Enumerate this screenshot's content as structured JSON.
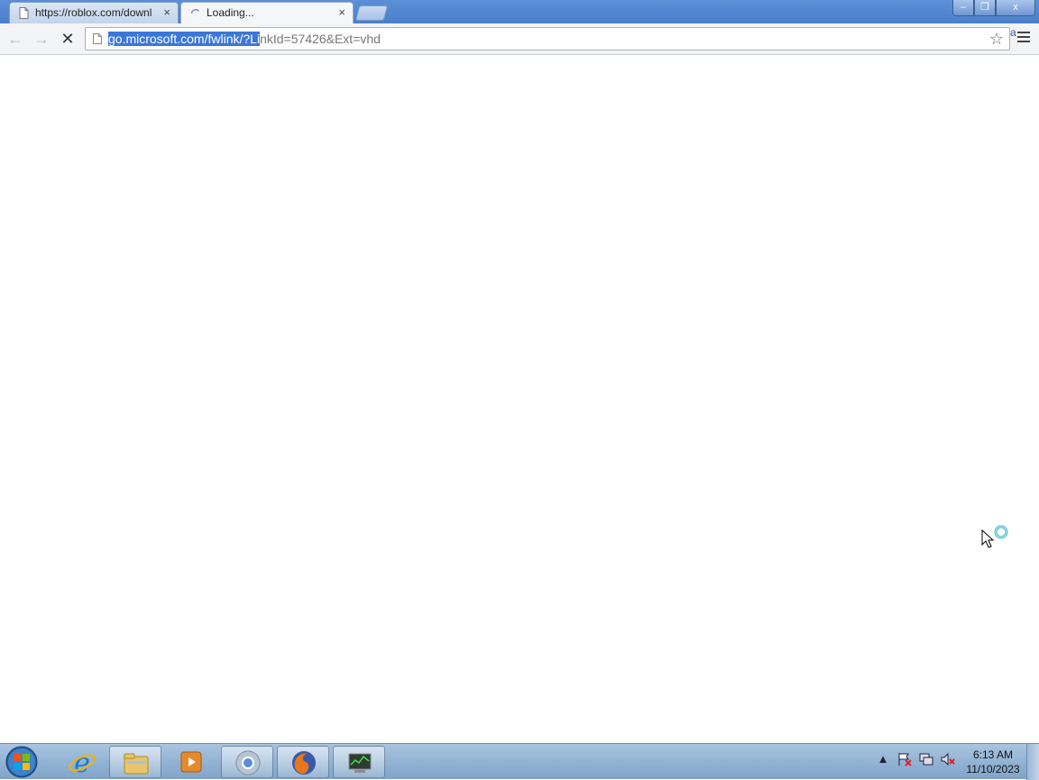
{
  "tabs": [
    {
      "title": "https://roblox.com/downl",
      "close": "×"
    },
    {
      "title": "Loading...",
      "close": "×"
    }
  ],
  "window_controls": {
    "minimize": "–",
    "maximize": "❐",
    "close": "x"
  },
  "toolbar": {
    "back": "←",
    "forward": "→",
    "stop": "✕",
    "star": "☆",
    "extension": "a"
  },
  "address_bar": {
    "url_selected": "go.microsoft.com/fwlink/?Li",
    "url_rest": "nkId=57426&Ext=vhd"
  },
  "taskbar": {
    "items": [
      "start",
      "internet-explorer",
      "file-explorer",
      "media-player",
      "chrome",
      "firefox",
      "task-manager"
    ],
    "tray_arrow": "▲",
    "clock": {
      "time": "6:13 AM",
      "date": "11/10/2023"
    }
  },
  "colors": {
    "selection": "#3b76d9",
    "titlebar": "#5b8fd6",
    "taskbar": "#8fb0d4"
  }
}
